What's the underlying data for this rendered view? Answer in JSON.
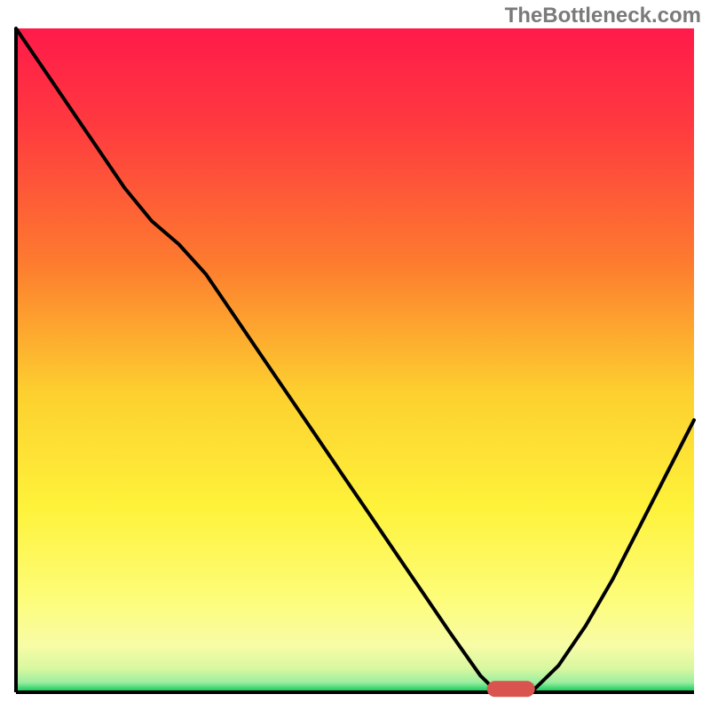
{
  "watermark": "TheBottleneck.com",
  "chart_data": {
    "type": "line",
    "title": "",
    "xlabel": "",
    "ylabel": "",
    "xlim": [
      0,
      100
    ],
    "ylim": [
      0,
      100
    ],
    "grid": false,
    "marker": {
      "x": 73,
      "y": 0.5,
      "color": "#d9534f"
    },
    "gradient_stops": [
      {
        "offset": 0.0,
        "color": "#ff1a4a"
      },
      {
        "offset": 0.15,
        "color": "#ff3b3f"
      },
      {
        "offset": 0.35,
        "color": "#fd7a2f"
      },
      {
        "offset": 0.55,
        "color": "#fdd02f"
      },
      {
        "offset": 0.72,
        "color": "#fef23a"
      },
      {
        "offset": 0.86,
        "color": "#fdfd7a"
      },
      {
        "offset": 0.93,
        "color": "#f7fca6"
      },
      {
        "offset": 0.965,
        "color": "#d7f7a0"
      },
      {
        "offset": 0.985,
        "color": "#9ceea0"
      },
      {
        "offset": 1.0,
        "color": "#00c853"
      }
    ],
    "series": [
      {
        "name": "bottleneck-curve",
        "color": "#000000",
        "x": [
          0.0,
          4.0,
          8.0,
          12.0,
          16.0,
          20.0,
          24.0,
          28.0,
          32.0,
          36.0,
          40.0,
          44.0,
          48.0,
          52.0,
          56.0,
          60.0,
          64.0,
          68.5,
          71.0,
          76.0,
          80.0,
          84.0,
          88.0,
          92.0,
          96.0,
          100.0
        ],
        "y": [
          100.0,
          94.0,
          88.0,
          82.0,
          76.0,
          71.0,
          67.5,
          63.0,
          57.0,
          51.0,
          45.0,
          39.0,
          33.0,
          27.0,
          21.0,
          15.0,
          9.0,
          2.5,
          0.0,
          0.0,
          4.0,
          10.0,
          17.0,
          25.0,
          33.0,
          41.0
        ]
      }
    ]
  }
}
